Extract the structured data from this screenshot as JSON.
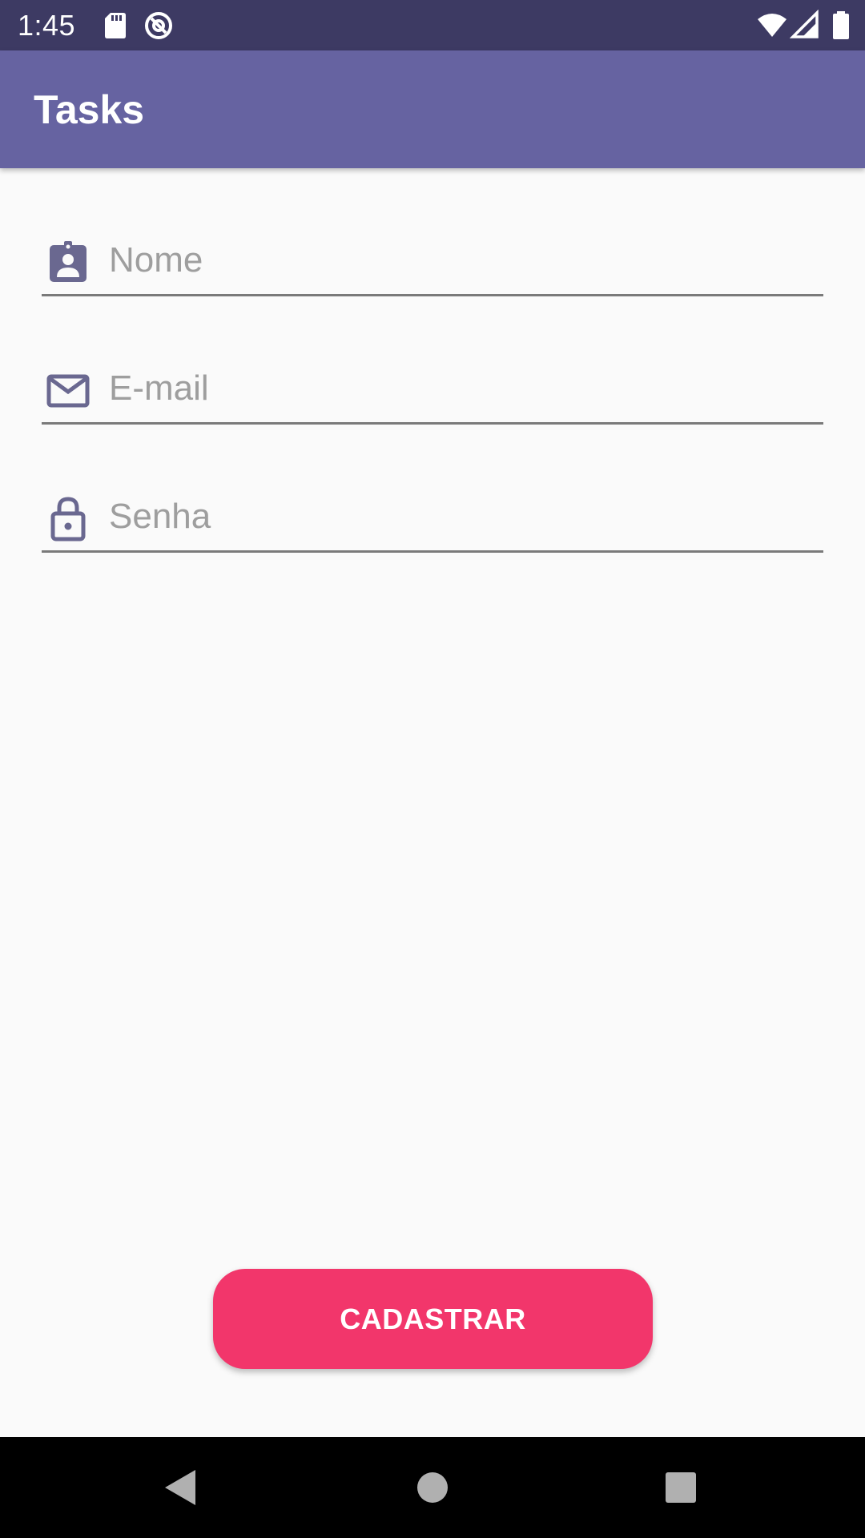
{
  "status_bar": {
    "time": "1:45",
    "icons": [
      "sd-card-icon",
      "at-sign-icon",
      "wifi-icon",
      "signal-icon",
      "battery-icon"
    ]
  },
  "app_bar": {
    "title": "Tasks"
  },
  "form": {
    "name_field": {
      "placeholder": "Nome",
      "icon": "badge-person-icon"
    },
    "email_field": {
      "placeholder": "E-mail",
      "icon": "mail-icon"
    },
    "password_field": {
      "placeholder": "Senha",
      "icon": "lock-icon"
    }
  },
  "register_button": {
    "label": "CADASTRAR"
  },
  "nav_bar": {
    "icons": [
      "back-icon",
      "home-icon",
      "recents-icon"
    ]
  },
  "colors": {
    "status_bar": "#3d3a63",
    "app_bar": "#6663a1",
    "accent": "#f2366b",
    "icon_tint": "#6a6890",
    "background": "#fafafa"
  }
}
